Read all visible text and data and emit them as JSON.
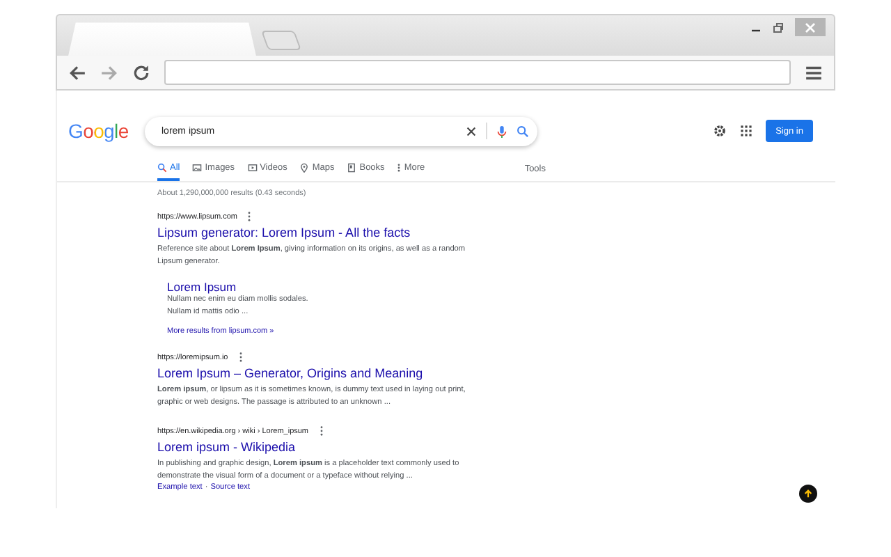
{
  "google": {
    "logo": "Google",
    "search": {
      "value": "lorem ipsum"
    },
    "tabs": [
      {
        "label": "All",
        "kind": "search",
        "selected": true
      },
      {
        "label": "Images",
        "kind": "images",
        "selected": false
      },
      {
        "label": "Videos",
        "kind": "videos",
        "selected": false
      },
      {
        "label": "Maps",
        "kind": "maps",
        "selected": false
      },
      {
        "label": "Books",
        "kind": "books",
        "selected": false
      },
      {
        "label": "More",
        "kind": "more",
        "selected": false
      }
    ],
    "tools": "Tools",
    "sign_in": "Sign in",
    "result_stats": "About 1,290,000,000 results (0.43 seconds)",
    "results": [
      {
        "url": "https://www.lipsum.com",
        "title": "Lipsum generator: Lorem Ipsum - All the facts",
        "snippet": "Reference site about **Lorem Ipsum**, giving information on its origins, as well as a random Lipsum generator.",
        "sitelinks": [
          {
            "title": "Lorem Ipsum",
            "snippet": "Nullam nec enim eu diam mollis sodales. Nullam id mattis odio ..."
          }
        ],
        "more": "More results from lipsum.com »"
      },
      {
        "url": "https://loremipsum.io",
        "title": "Lorem Ipsum – Generator, Origins and Meaning",
        "snippet": "**Lorem ipsum**, or lipsum as it is sometimes known, is dummy text used in laying out print, graphic or web designs. The passage is attributed to an unknown ..."
      },
      {
        "url": "https://en.wikipedia.org › wiki › Lorem_ipsum",
        "title": "Lorem ipsum - Wikipedia",
        "snippet": "In publishing and graphic design, **Lorem ipsum** is a placeholder text commonly used to demonstrate the visual form of a document or a typeface without relying ...",
        "links": [
          "Example text",
          "Source text"
        ],
        "link_separator": "·"
      }
    ]
  }
}
